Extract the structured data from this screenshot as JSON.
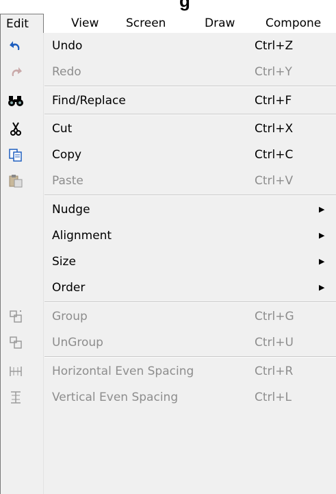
{
  "title_fragment": "g",
  "menubar": {
    "items": [
      {
        "label": "Edit",
        "active": true
      },
      {
        "label": "View"
      },
      {
        "label": "Screen"
      },
      {
        "label": "Draw"
      },
      {
        "label": "Compone"
      }
    ]
  },
  "menu": {
    "items": [
      {
        "label": "Undo",
        "shortcut": "Ctrl+Z",
        "icon": "undo-icon",
        "enabled": true
      },
      {
        "label": "Redo",
        "shortcut": "Ctrl+Y",
        "icon": "redo-icon",
        "enabled": false
      },
      {
        "label": "Find/Replace",
        "shortcut": "Ctrl+F",
        "icon": "binoculars-icon",
        "enabled": true
      },
      {
        "label": "Cut",
        "shortcut": "Ctrl+X",
        "icon": "scissors-icon",
        "enabled": true
      },
      {
        "label": "Copy",
        "shortcut": "Ctrl+C",
        "icon": "copy-icon",
        "enabled": true
      },
      {
        "label": "Paste",
        "shortcut": "Ctrl+V",
        "icon": "paste-icon",
        "enabled": false
      },
      {
        "label": "Nudge",
        "submenu": true,
        "enabled": true
      },
      {
        "label": "Alignment",
        "submenu": true,
        "enabled": true
      },
      {
        "label": "Size",
        "submenu": true,
        "enabled": true
      },
      {
        "label": "Order",
        "submenu": true,
        "enabled": true
      },
      {
        "label": "Group",
        "shortcut": "Ctrl+G",
        "icon": "group-icon",
        "enabled": false
      },
      {
        "label": "UnGroup",
        "shortcut": "Ctrl+U",
        "icon": "ungroup-icon",
        "enabled": false
      },
      {
        "label": "Horizontal Even Spacing",
        "shortcut": "Ctrl+R",
        "icon": "horizontal-spacing-icon",
        "enabled": false
      },
      {
        "label": "Vertical Even Spacing",
        "shortcut": "Ctrl+L",
        "icon": "vertical-spacing-icon",
        "enabled": false
      }
    ]
  },
  "colors": {
    "disabled_text": "#8d8d8d",
    "menu_bg": "#f0f0f0",
    "icon_blue": "#1f5fbf"
  }
}
